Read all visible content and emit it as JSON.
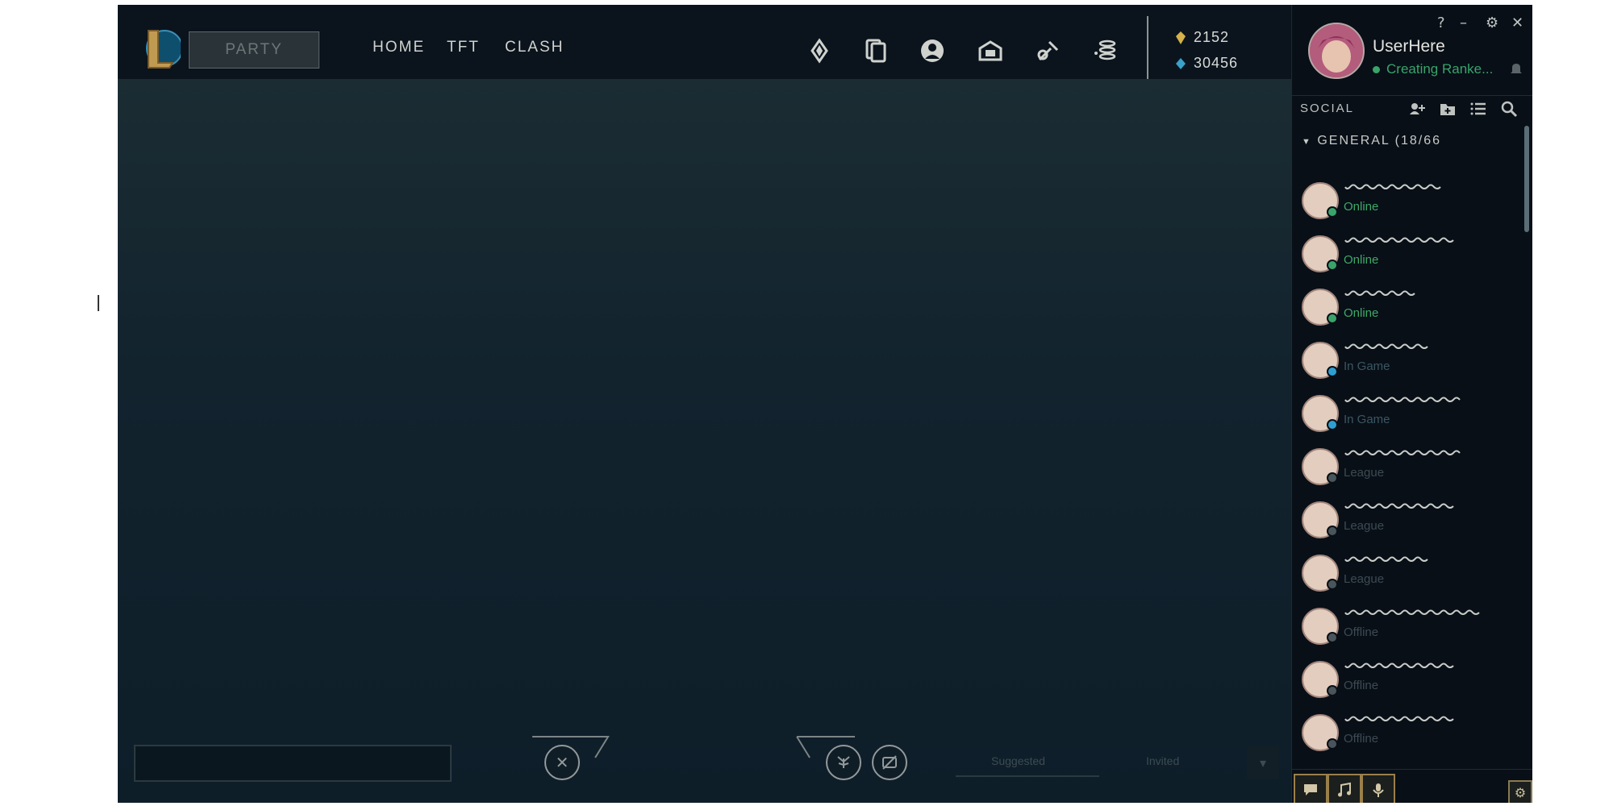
{
  "app": {
    "party_label": "PARTY",
    "nav": [
      "HOME",
      "TFT",
      "CLASH"
    ],
    "currency": {
      "blue_essence": "2152",
      "riot_points": "30456"
    },
    "icons": [
      "loot-icon",
      "collection-icon",
      "profile-icon",
      "store-icon",
      "crafting-icon",
      "essence-icon"
    ]
  },
  "window_controls": [
    "?",
    "–",
    "⚙",
    "✕"
  ],
  "user": {
    "name": "UserHere",
    "status": "Creating Ranke...",
    "status_color": "#3aa36a"
  },
  "social": {
    "title": "SOCIAL",
    "group_label": "GENERAL (18/66",
    "friends": [
      {
        "status": "Online",
        "color": "#3fa867"
      },
      {
        "status": "Online",
        "color": "#3fa867"
      },
      {
        "status": "Online",
        "color": "#3fa867"
      },
      {
        "status": "In Game",
        "color": "#3b5663"
      },
      {
        "status": "In Game",
        "color": "#3b5663"
      },
      {
        "status": "League",
        "color": "#3d4a52"
      },
      {
        "status": "League",
        "color": "#3d4a52"
      },
      {
        "status": "League",
        "color": "#3d4a52"
      },
      {
        "status": "Offline",
        "color": "#3d4a52"
      },
      {
        "status": "Offline",
        "color": "#3d4a52"
      },
      {
        "status": "Offline",
        "color": "#3d4a52"
      }
    ]
  },
  "lobby": {
    "tab_suggested": "Suggested",
    "tab_invited": "Invited"
  },
  "colors": {
    "accent_gold": "#c8aa6e",
    "online": "#3aa36a",
    "in_game": "#2f9fd0"
  }
}
